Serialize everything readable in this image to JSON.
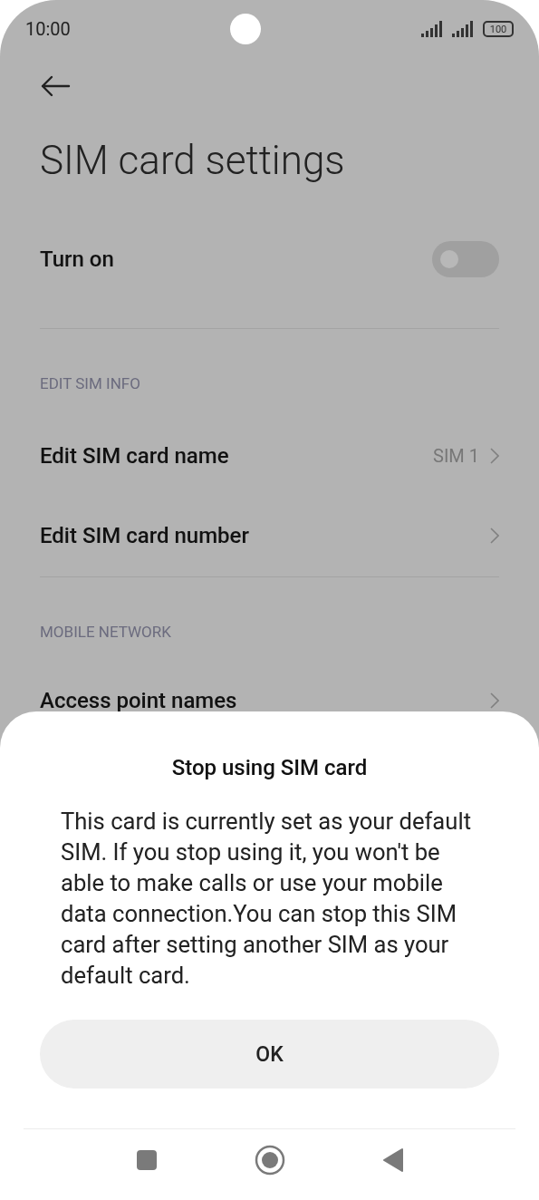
{
  "status_bar": {
    "time": "10:00",
    "battery": "100"
  },
  "page": {
    "title": "SIM card settings",
    "toggle": {
      "label": "Turn on",
      "on": false
    },
    "sections": [
      {
        "header": "EDIT SIM INFO",
        "items": [
          {
            "label": "Edit SIM card name",
            "value": "SIM 1"
          },
          {
            "label": "Edit SIM card number"
          }
        ]
      },
      {
        "header": "MOBILE NETWORK",
        "items": [
          {
            "label": "Access point names"
          }
        ]
      }
    ]
  },
  "dialog": {
    "title": "Stop using SIM card",
    "message": "This card is currently set as your default SIM. If you stop using it, you won't be able to make calls or use your mobile data connection.You can stop this SIM card after setting another SIM as your default card.",
    "button": "OK"
  }
}
